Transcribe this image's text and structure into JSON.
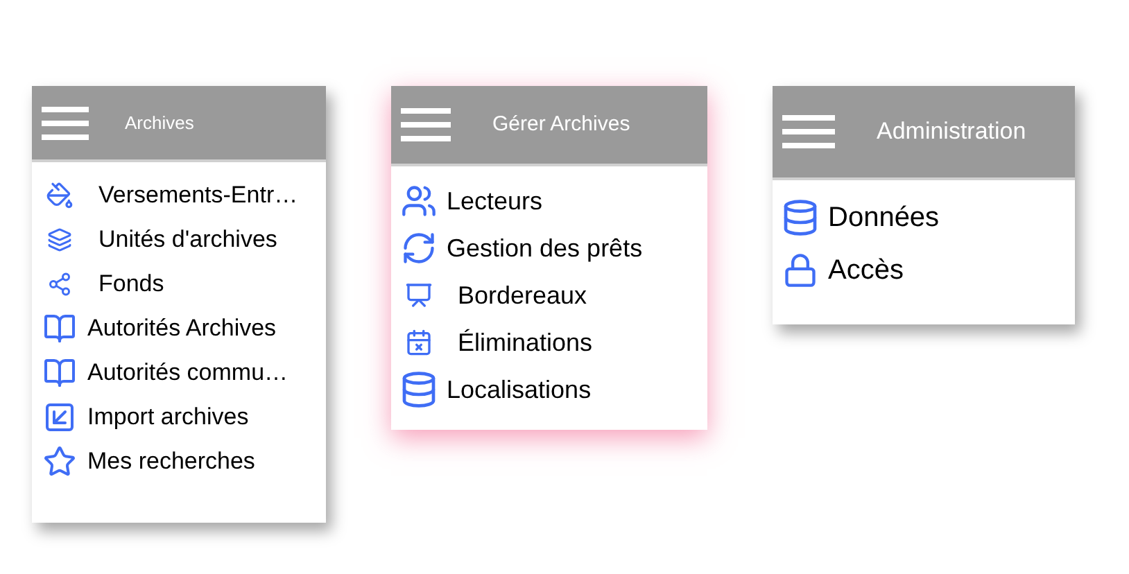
{
  "menus": [
    {
      "title": "Archives",
      "selected": false,
      "items": [
        {
          "label": "Versements-Entr…"
        },
        {
          "label": "Unités d'archives"
        },
        {
          "label": "Fonds"
        },
        {
          "label": "Autorités Archives"
        },
        {
          "label": "Autorités commu…"
        },
        {
          "label": "Import archives"
        },
        {
          "label": "Mes recherches"
        }
      ]
    },
    {
      "title": "Gérer Archives",
      "selected": true,
      "items": [
        {
          "label": "Lecteurs"
        },
        {
          "label": "Gestion des prêts"
        },
        {
          "label": "Bordereaux"
        },
        {
          "label": "Éliminations"
        },
        {
          "label": "Localisations"
        }
      ]
    },
    {
      "title": "Administration",
      "selected": false,
      "items": [
        {
          "label": "Données"
        },
        {
          "label": "Accès"
        }
      ]
    }
  ]
}
